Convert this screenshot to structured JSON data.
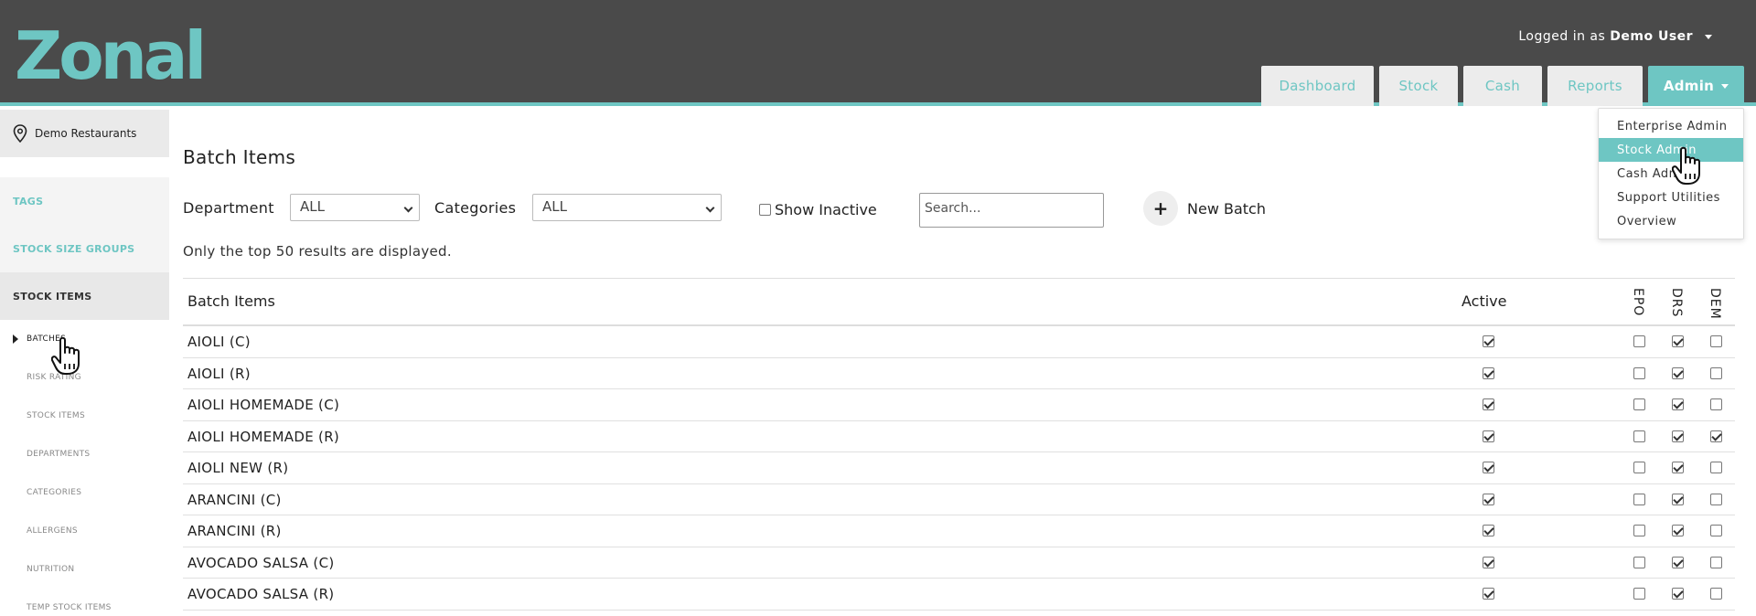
{
  "header": {
    "logo": "Zonal",
    "user_prefix": "Logged in as",
    "user_name": "Demo User",
    "tabs": [
      {
        "label": "Dashboard"
      },
      {
        "label": "Stock"
      },
      {
        "label": "Cash"
      },
      {
        "label": "Reports"
      },
      {
        "label": "Admin"
      }
    ],
    "accent_color": "#6ec6c3",
    "bar_color": "#4a4a4a"
  },
  "admin_menu": {
    "items": [
      {
        "label": "Enterprise Admin"
      },
      {
        "label": "Stock Admin"
      },
      {
        "label": "Cash Admin"
      },
      {
        "label": "Support Utilities"
      },
      {
        "label": "Overview"
      }
    ],
    "selected": "Stock Admin"
  },
  "sidebar": {
    "site_name": "Demo Restaurants",
    "sections": [
      {
        "label": "TAGS"
      },
      {
        "label": "STOCK SIZE GROUPS"
      },
      {
        "label": "STOCK ITEMS"
      }
    ],
    "sub_items": [
      {
        "label": "BATCHES"
      },
      {
        "label": "RISK RATING"
      },
      {
        "label": "STOCK ITEMS"
      },
      {
        "label": "DEPARTMENTS"
      },
      {
        "label": "CATEGORIES"
      },
      {
        "label": "ALLERGENS"
      },
      {
        "label": "NUTRITION"
      },
      {
        "label": "TEMP STOCK ITEMS"
      }
    ]
  },
  "main": {
    "title": "Batch Items",
    "department_label": "Department",
    "department_value": "ALL",
    "categories_label": "Categories",
    "categories_value": "ALL",
    "show_inactive_label": "Show Inactive",
    "search_placeholder": "Search...",
    "new_batch_label": "New Batch",
    "notice": "Only the top 50 results are displayed."
  },
  "table": {
    "headers": {
      "name": "Batch Items",
      "active": "Active",
      "epo": "EPO",
      "drs": "DRS",
      "dem": "DEM"
    },
    "rows": [
      {
        "name": "AIOLI (C)",
        "active": true,
        "epo": false,
        "drs": true,
        "dem": false
      },
      {
        "name": "AIOLI (R)",
        "active": true,
        "epo": false,
        "drs": true,
        "dem": false
      },
      {
        "name": "AIOLI HOMEMADE (C)",
        "active": true,
        "epo": false,
        "drs": true,
        "dem": false
      },
      {
        "name": "AIOLI HOMEMADE (R)",
        "active": true,
        "epo": false,
        "drs": true,
        "dem": true
      },
      {
        "name": "AIOLI NEW (R)",
        "active": true,
        "epo": false,
        "drs": true,
        "dem": false
      },
      {
        "name": "ARANCINI (C)",
        "active": true,
        "epo": false,
        "drs": true,
        "dem": false
      },
      {
        "name": "ARANCINI (R)",
        "active": true,
        "epo": false,
        "drs": true,
        "dem": false
      },
      {
        "name": "AVOCADO SALSA (C)",
        "active": true,
        "epo": false,
        "drs": true,
        "dem": false
      },
      {
        "name": "AVOCADO SALSA (R)",
        "active": true,
        "epo": false,
        "drs": true,
        "dem": false
      }
    ]
  }
}
